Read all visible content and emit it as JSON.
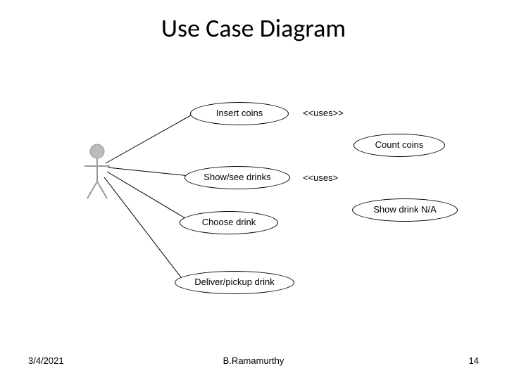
{
  "title": "Use Case Diagram",
  "usecases": {
    "insert_coins": "Insert coins",
    "count_coins": "Count coins",
    "show_see_drinks": "Show/see drinks",
    "show_drink_na": "Show drink N/A",
    "choose_drink": "Choose drink",
    "deliver_pickup": "Deliver/pickup drink"
  },
  "relations": {
    "uses1": "<<uses>>",
    "uses2": "<<uses>"
  },
  "footer": {
    "date": "3/4/2021",
    "author": "B.Ramamurthy",
    "page": "14"
  }
}
